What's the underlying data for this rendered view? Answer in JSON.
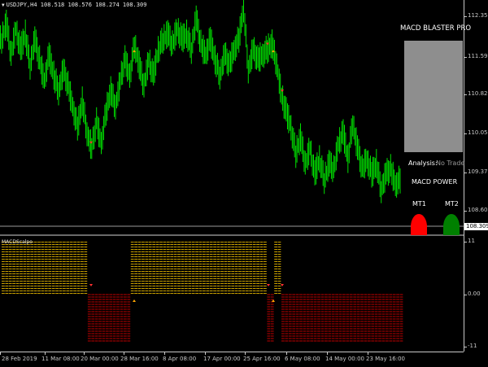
{
  "symbol": {
    "arrow": "▼",
    "text": "USDJPY,H4  108.518 108.576 108.274 108.309"
  },
  "indicator_name": "MACDScalpo",
  "price_axis": {
    "labels": [
      "112.350",
      "111.590",
      "110.820",
      "110.050",
      "109.370",
      "108.600"
    ],
    "current_price": "108.309"
  },
  "indicator_axis": {
    "labels": [
      "11",
      "0.00",
      "-11"
    ]
  },
  "time_axis": {
    "labels": [
      "28 Feb 2019",
      "11 Mar 08:00",
      "20 Mar 00:00",
      "28 Mar 16:00",
      "8 Apr 08:00",
      "17 Apr 00:00",
      "25 Apr 16:00",
      "6 May 08:00",
      "14 May 00:00",
      "23 May 16:00"
    ]
  },
  "panel": {
    "title": "MACD BLASTER PRO",
    "analysis_label": "Analysis:",
    "analysis_value": "No Trade",
    "power_label": "MACD POWER",
    "mt1_label": "MT1",
    "mt2_label": "MT2",
    "mt1_color": "#ff0000",
    "mt2_color": "#008000"
  },
  "colors": {
    "candles": "#00e000",
    "bull_hist": "#c8a000",
    "bear_hist": "#c00000",
    "signal_up": "#ffa500",
    "signal_down": "#ff3030"
  },
  "chart_data": {
    "type": "line",
    "series": [
      {
        "values": [
          111.9,
          112.2,
          111.6,
          112.1,
          111.7,
          112.0,
          111.4,
          111.9,
          111.5,
          111.1,
          111.6,
          111.2,
          110.9,
          111.3,
          111.0,
          110.6,
          110.2,
          110.7,
          110.1,
          109.8,
          110.3,
          109.9,
          110.5,
          110.9,
          110.6,
          111.1,
          111.5,
          111.2,
          111.8,
          111.4,
          111.0,
          111.5,
          111.2,
          111.7,
          111.9,
          112.0,
          111.8,
          112.1,
          111.9,
          112.0,
          111.7,
          112.3,
          111.8,
          111.6,
          111.9,
          111.5,
          111.2,
          111.6,
          111.4,
          111.7,
          111.9,
          112.5,
          111.3,
          111.7,
          111.5,
          111.6,
          111.7,
          111.8,
          111.4,
          110.8,
          110.5,
          110.2,
          109.7,
          110.0,
          109.5,
          109.8,
          109.3,
          109.6,
          109.2,
          109.5,
          109.4,
          109.9,
          110.1,
          109.6,
          110.3,
          109.8,
          109.4,
          109.6,
          109.3,
          109.5,
          109.0,
          109.3,
          109.4,
          109.1,
          109.2
        ]
      }
    ],
    "histogram": [
      11,
      11,
      11,
      11,
      11,
      11,
      11,
      11,
      11,
      11,
      11,
      11,
      11,
      11,
      11,
      11,
      11,
      11,
      11,
      11,
      11,
      11,
      11,
      11,
      -10,
      -10,
      -10,
      -10,
      -10,
      -10,
      -10,
      -10,
      -10,
      -10,
      -10,
      -10,
      11,
      11,
      11,
      11,
      11,
      11,
      11,
      11,
      11,
      11,
      11,
      11,
      11,
      11,
      11,
      11,
      11,
      11,
      11,
      11,
      11,
      11,
      11,
      11,
      11,
      11,
      11,
      11,
      11,
      11,
      11,
      11,
      11,
      11,
      11,
      11,
      11,
      11,
      -10,
      -10,
      11,
      11,
      -10,
      -10,
      -10,
      -10,
      -10,
      -10,
      -10,
      -10,
      -10,
      -10,
      -10,
      -10,
      -10,
      -10,
      -10,
      -10,
      -10,
      -10,
      -10,
      -10,
      -10,
      -10,
      -10,
      -10,
      -10,
      -10,
      -10,
      -10,
      -10,
      -10,
      -10,
      -10,
      -10,
      -10
    ],
    "ylim": [
      108.309,
      112.35
    ],
    "hist_ylim": [
      -11,
      11
    ]
  }
}
